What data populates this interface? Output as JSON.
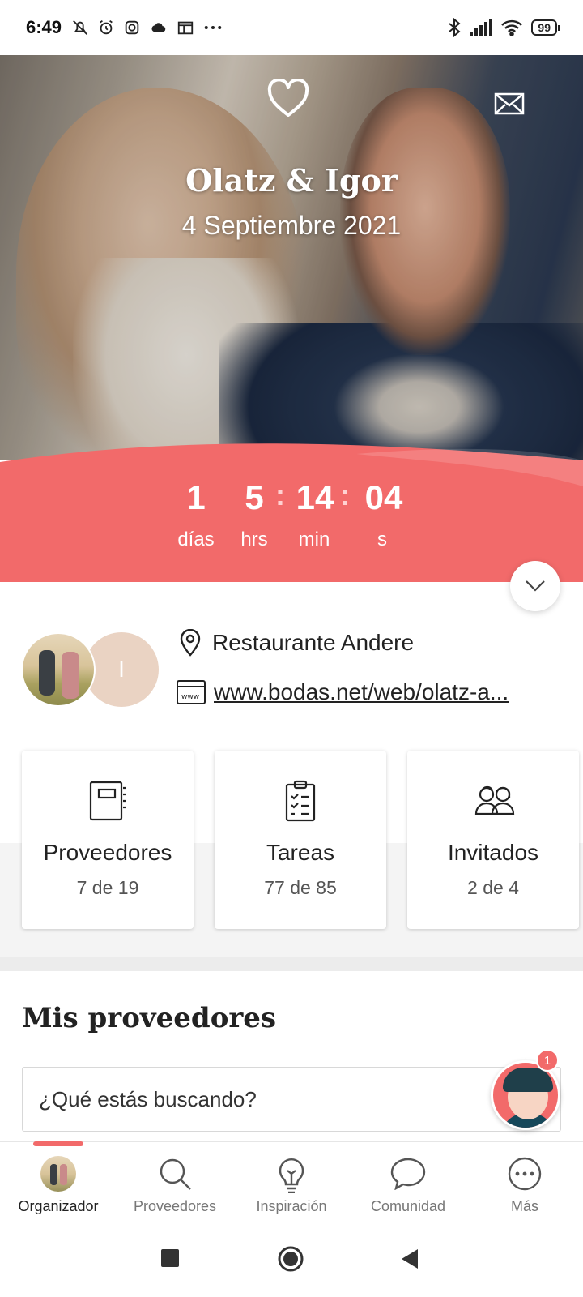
{
  "status_bar": {
    "time": "6:49",
    "battery": "99",
    "left_icons": [
      "bell-off-icon",
      "alarm-icon",
      "instagram-icon",
      "cloud-icon",
      "calendar-icon",
      "more-dots-icon"
    ],
    "right_icons": [
      "bluetooth-icon",
      "signal-icon",
      "wifi-icon",
      "battery-icon"
    ]
  },
  "hero": {
    "names": "Olatz & Igor",
    "date": "4 Septiembre 2021"
  },
  "countdown": {
    "days": "1",
    "hours": "5",
    "minutes": "14",
    "seconds": "04",
    "days_label": "días",
    "hours_label": "hrs",
    "minutes_label": "min",
    "seconds_label": "s",
    "separator": ":",
    "accent_color": "#F26A6A"
  },
  "info": {
    "avatar_initial": "I",
    "venue": "Restaurante Andere",
    "website": "www.bodas.net/web/olatz-a..."
  },
  "cards": [
    {
      "title": "Proveedores",
      "subtitle": "7 de 19"
    },
    {
      "title": "Tareas",
      "subtitle": "77 de 85"
    },
    {
      "title": "Invitados",
      "subtitle": "2 de 4"
    }
  ],
  "providers_section": {
    "title": "Mis proveedores",
    "search_placeholder": "¿Qué estás buscando?"
  },
  "assistant": {
    "badge": "1"
  },
  "bottom_nav": [
    {
      "label": "Organizador",
      "active": true
    },
    {
      "label": "Proveedores",
      "active": false
    },
    {
      "label": "Inspiración",
      "active": false
    },
    {
      "label": "Comunidad",
      "active": false
    },
    {
      "label": "Más",
      "active": false
    }
  ]
}
